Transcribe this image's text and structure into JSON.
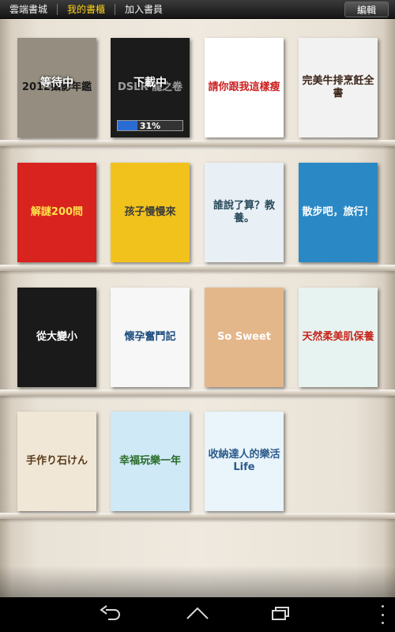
{
  "topbar": {
    "tabs": [
      {
        "label": "雲端書城",
        "active": false
      },
      {
        "label": "我的書櫃",
        "active": true
      },
      {
        "label": "加入書員",
        "active": false
      }
    ],
    "edit_label": "編輯",
    "accent": "#ffd21a"
  },
  "books": [
    {
      "title": "2012攝影年鑑",
      "cover": "#f1e4cf",
      "fg": "#2b2b2b",
      "status": "等待中"
    },
    {
      "title": "DSLR 龍之卷",
      "cover": "#2d2d2d",
      "fg": "#ffffff",
      "status": "下載中",
      "progress_text": "31%",
      "progress": 0.31
    },
    {
      "title": "請你跟我這樣瘦",
      "cover": "#ffffff",
      "fg": "#cc1f1f"
    },
    {
      "title": "完美牛排烹飪全書",
      "cover": "#f2f2f2",
      "fg": "#3a2418"
    },
    {
      "title": "解謎200問",
      "cover": "#d9231f",
      "fg": "#ffe34a"
    },
    {
      "title": "孩子慢慢來",
      "cover": "#f1c21b",
      "fg": "#3c3c3c"
    },
    {
      "title": "誰說了算？教養。",
      "cover": "#e8f0f5",
      "fg": "#2a4a5c"
    },
    {
      "title": "散步吧，旅行！",
      "cover": "#2a89c5",
      "fg": "#ffffff"
    },
    {
      "title": "從大變小",
      "cover": "#1a1a1a",
      "fg": "#ffffff"
    },
    {
      "title": "懷孕奮鬥記",
      "cover": "#f7f7f7",
      "fg": "#1b4b7d"
    },
    {
      "title": "So Sweet",
      "cover": "#e4b78b",
      "fg": "#ffffff"
    },
    {
      "title": "天然柔美肌保養",
      "cover": "#e7f3f0",
      "fg": "#c7261d"
    },
    {
      "title": "手作り石けん",
      "cover": "#f0e7d7",
      "fg": "#5a3a1a"
    },
    {
      "title": "幸福玩樂一年",
      "cover": "#cfe9f7",
      "fg": "#2a6d2a"
    },
    {
      "title": "收納達人的樂活Life",
      "cover": "#e9f4fb",
      "fg": "#2b5a8a"
    }
  ],
  "nav": {
    "back_icon": "back-arrow-icon",
    "home_icon": "home-icon",
    "recent_icon": "recent-apps-icon"
  }
}
